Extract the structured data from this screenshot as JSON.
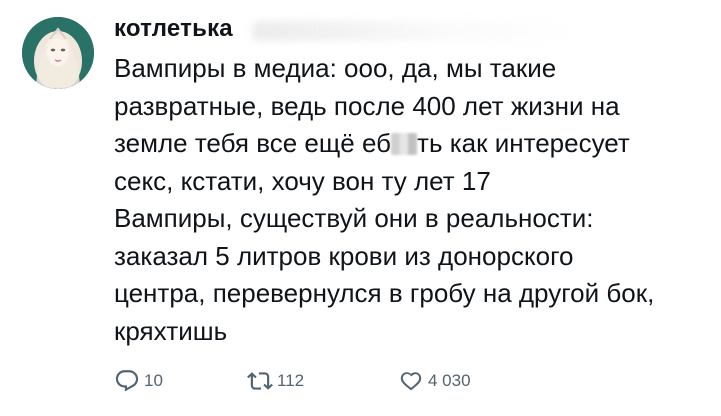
{
  "tweet": {
    "author_name": "котлетька",
    "lines": [
      "Вампиры в медиа: ооо, да, мы такие",
      "развратные, ведь после 400 лет жизни на"
    ],
    "line3_before": "земле тебя все ещё еб",
    "line3_after": "ть как интересует",
    "lines_rest": [
      "секс, кстати, хочу вон ту лет 17",
      "Вампиры, существуй они в реальности:",
      "заказал 5 литров крови из донорского",
      "центра, перевернулся в гробу на другой бок,",
      "кряхтишь"
    ]
  },
  "actions": {
    "reply_count": "10",
    "retweet_count": "112",
    "like_count": "4 030",
    "icons": {
      "reply": "speech-bubble-icon",
      "retweet": "retweet-arrows-icon",
      "like": "heart-icon"
    }
  },
  "colors": {
    "text": "#0f1419",
    "muted": "#536471",
    "background": "#ffffff"
  }
}
